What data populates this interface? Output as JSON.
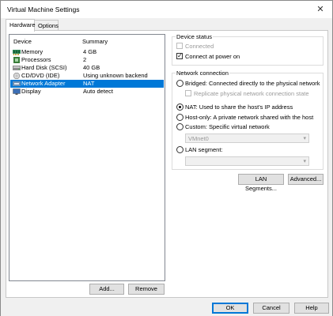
{
  "window": {
    "title": "Virtual Machine Settings",
    "close_glyph": "✕"
  },
  "tabs": [
    {
      "label": "Hardware",
      "active": true
    },
    {
      "label": "Options",
      "active": false
    }
  ],
  "device_list": {
    "columns": {
      "device": "Device",
      "summary": "Summary"
    },
    "rows": [
      {
        "icon": "memory-icon",
        "name": "Memory",
        "summary": "4 GB",
        "selected": false
      },
      {
        "icon": "processor-icon",
        "name": "Processors",
        "summary": "2",
        "selected": false
      },
      {
        "icon": "hard-disk-icon",
        "name": "Hard Disk (SCSI)",
        "summary": "40 GB",
        "selected": false
      },
      {
        "icon": "cd-dvd-icon",
        "name": "CD/DVD (IDE)",
        "summary": "Using unknown backend",
        "selected": false
      },
      {
        "icon": "network-adapter-icon",
        "name": "Network Adapter",
        "summary": "NAT",
        "selected": true
      },
      {
        "icon": "display-icon",
        "name": "Display",
        "summary": "Auto detect",
        "selected": false
      }
    ],
    "add_label": "Add...",
    "remove_label": "Remove"
  },
  "device_status": {
    "legend": "Device status",
    "connected_label": "Connected",
    "connected_checked": false,
    "connected_enabled": false,
    "connect_at_power_on_label": "Connect at power on",
    "connect_at_power_on_checked": true
  },
  "network_connection": {
    "legend": "Network connection",
    "options": {
      "bridged": "Bridged: Connected directly to the physical network",
      "replicate": "Replicate physical network connection state",
      "nat": "NAT: Used to share the host's IP address",
      "host_only": "Host-only: A private network shared with the host",
      "custom": "Custom: Specific virtual network",
      "lan_segment": "LAN segment:"
    },
    "selected": "nat",
    "custom_network_value": "VMnet0",
    "lan_segment_value": ""
  },
  "buttons": {
    "lan_segments": "LAN Segments...",
    "advanced": "Advanced...",
    "ok": "OK",
    "cancel": "Cancel",
    "help": "Help"
  },
  "colors": {
    "selection": "#0078d7",
    "button_face": "#e1e1e1"
  }
}
